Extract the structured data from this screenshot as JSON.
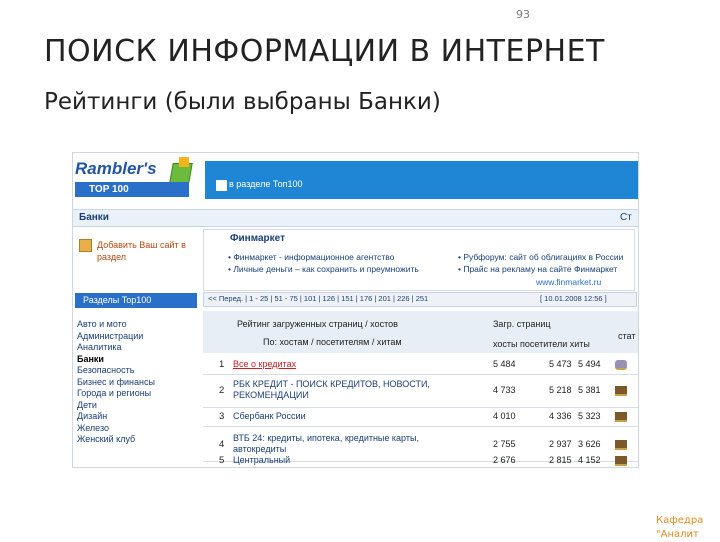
{
  "slide": {
    "page_number": "93",
    "title": "ПОИСК ИНФОРМАЦИИ В ИНТЕРНЕТ",
    "subtitle": "Рейтинги (были выбраны Банки)",
    "footer_line1": "Кафедра",
    "footer_line2": "\"Аналит"
  },
  "rambler": {
    "logo": "Rambler's",
    "top100": "TOP 100",
    "checkbox_label": "в разделе Топ100",
    "category": "Банки",
    "category_right": "Ст",
    "add_site": "Добавить Ваш сайт в раздел",
    "sections_title": "Разделы Top100",
    "sections": [
      {
        "label": "Авто и мото",
        "active": false
      },
      {
        "label": "Администрации",
        "active": false
      },
      {
        "label": "Аналитика",
        "active": false
      },
      {
        "label": "Банки",
        "active": true
      },
      {
        "label": "Безопасность",
        "active": false
      },
      {
        "label": "Бизнес и финансы",
        "active": false
      },
      {
        "label": "Города и регионы",
        "active": false
      },
      {
        "label": "Дети",
        "active": false
      },
      {
        "label": "Дизайн",
        "active": false
      },
      {
        "label": "Железо",
        "active": false
      },
      {
        "label": "Женский клуб",
        "active": false
      }
    ],
    "finmarket": {
      "title": "Финмаркет",
      "left_links": [
        "• Финмаркет - информационное агентство",
        "• Личные деньги – как сохранить и преумножить"
      ],
      "right_links": [
        "• Рубфорум: сайт об облигациях в России",
        "• Прайс на рекламу на сайте Финмаркет"
      ],
      "site_link": "www.finmarket.ru"
    },
    "pager": {
      "left": "<< Перед. | 1 - 25 | 51 - 75 | 101 | 126 | 151 | 176 | 201 | 226 | 251",
      "right": "[ 10.01.2008 12:56 ]"
    },
    "table_header": {
      "rating_title": "Рейтинг загруженных страниц / хостов",
      "sort_label": "По: хостам / посетителям / хитам",
      "stats_title": "Загр. страниц",
      "stats_cols": "хосты  посетители  хиты",
      "stat": "стат"
    },
    "rows": [
      {
        "num": "1",
        "name": "Все о кредитах",
        "red": true,
        "v1": "5 484",
        "v2": "5 473",
        "v3": "5 494"
      },
      {
        "num": "2",
        "name": "РБК КРЕДИТ - ПОИСК КРЕДИТОВ, НОВОСТИ, РЕКОМЕНДАЦИИ",
        "red": false,
        "v1": "4 733",
        "v2": "5 218",
        "v3": "5 381"
      },
      {
        "num": "3",
        "name": "Сбербанк России",
        "red": false,
        "v1": "4 010",
        "v2": "4 336",
        "v3": "5 323"
      },
      {
        "num": "4",
        "name": "ВТБ 24: кредиты, ипотека, кредитные карты, автокредиты",
        "red": false,
        "v1": "2 755",
        "v2": "2 937",
        "v3": "3 626"
      },
      {
        "num": "5",
        "name": "Центральный",
        "red": false,
        "v1": "2 676",
        "v2": "2 815",
        "v3": "4 152"
      }
    ]
  }
}
